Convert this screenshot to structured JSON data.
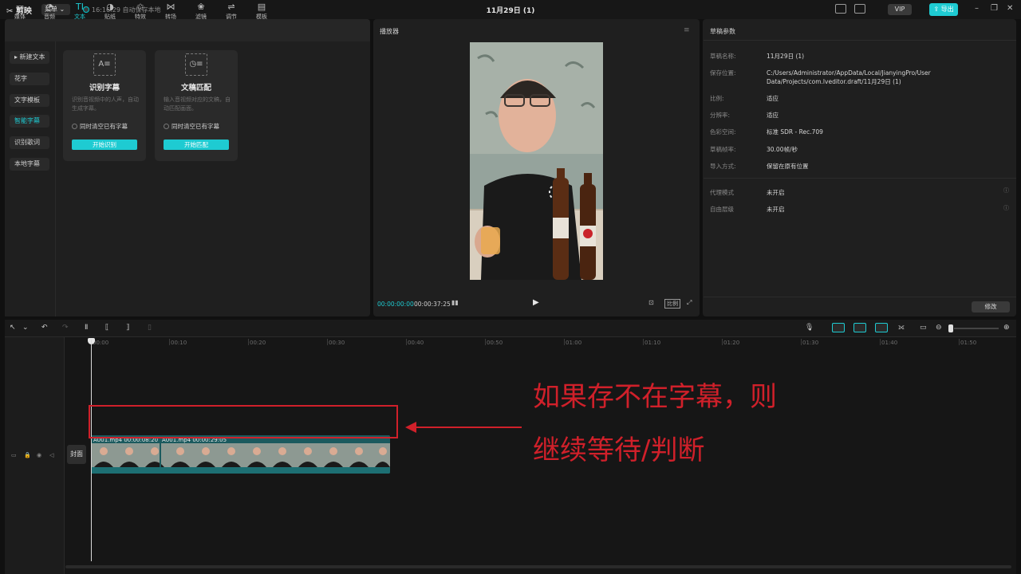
{
  "titlebar": {
    "app": "剪映",
    "menu": "菜单",
    "autosave": "16:16:29 自动保存本地",
    "title": "11月29日 (1)",
    "vip": "VIP",
    "export": "导出",
    "win_minimize": "–",
    "win_restore": "❐",
    "win_close": "✕"
  },
  "tools": [
    {
      "icon": "▭",
      "label": "媒体"
    },
    {
      "icon": "◔",
      "label": "音频"
    },
    {
      "icon": "TI",
      "label": "文本"
    },
    {
      "icon": "◑",
      "label": "贴纸"
    },
    {
      "icon": "✩",
      "label": "特效"
    },
    {
      "icon": "⋈",
      "label": "转场"
    },
    {
      "icon": "❀",
      "label": "滤镜"
    },
    {
      "icon": "⇌",
      "label": "调节"
    },
    {
      "icon": "▤",
      "label": "模板"
    }
  ],
  "active_tool": "文本",
  "sidenav": [
    "▸ 新建文本",
    "花字",
    "文字模板",
    "智能字幕",
    "识别歌词",
    "本地字幕"
  ],
  "active_sidenav": "智能字幕",
  "cards": [
    {
      "icon": "A≡",
      "title": "识别字幕",
      "desc": "识别音视频中的人声，自动生成字幕。",
      "check": "同时清空已有字幕",
      "button": "开始识别"
    },
    {
      "icon": "◷≡",
      "title": "文稿匹配",
      "desc": "输入音视频对应的文稿，自动匹配画面。",
      "check": "同时清空已有字幕",
      "button": "开始匹配"
    }
  ],
  "player": {
    "title": "播放器",
    "menu_icon": "≡",
    "current_time": "00:00:00:00",
    "total_time": "00:00:37:25",
    "play_icon": "▶",
    "ratio": "比例",
    "fit_icon": "⊡",
    "fullscreen_icon": "⤢"
  },
  "props": {
    "title": "草稿参数",
    "rows": [
      {
        "key": "草稿名称:",
        "value": "11月29日 (1)"
      },
      {
        "key": "保存位置:",
        "value": "C:/Users/Administrator/AppData/Local/JianyingPro/User Data/Projects/com.lveditor.draft/11月29日 (1)"
      },
      {
        "key": "比例:",
        "value": "适应"
      },
      {
        "key": "分辨率:",
        "value": "适应"
      },
      {
        "key": "色彩空间:",
        "value": "标准 SDR - Rec.709"
      },
      {
        "key": "草稿帧率:",
        "value": "30.00帧/秒"
      },
      {
        "key": "导入方式:",
        "value": "保留在原有位置"
      }
    ],
    "extra_rows": [
      {
        "key": "代理模式",
        "value": "未开启"
      },
      {
        "key": "自由层级",
        "value": "未开启"
      }
    ],
    "info_icon": "ⓘ",
    "modify": "修改"
  },
  "timeline": {
    "ruler": [
      "00:00",
      "00:10",
      "00:20",
      "00:30",
      "00:40",
      "00:50",
      "01:00",
      "01:10",
      "01:20",
      "01:30",
      "01:40",
      "01:50"
    ],
    "cover": "封面",
    "clip_labels": [
      "A001.mp4  00:00:08:20",
      "A001.mp4  00:00:29:05"
    ],
    "toolbar_icons": {
      "select": "↖",
      "select_menu": "⌄",
      "undo": "↶",
      "redo": "↷",
      "split": "Ⅱ",
      "split_left": "⟦",
      "split_right": "⟧",
      "delete": "▯",
      "mic": "🎙",
      "link": "⟗",
      "preview": "▭",
      "zoom_out": "⊖",
      "zoom_in": "⊕"
    },
    "track_icons": [
      "▭",
      "🔒",
      "◉",
      "◁"
    ]
  },
  "annotation": {
    "line1": "如果存不在字幕，则",
    "line2": "继续等待/判断",
    "color": "#d0202a"
  },
  "colors": {
    "accent": "#1ecbd2",
    "annotation": "#d0202a"
  }
}
